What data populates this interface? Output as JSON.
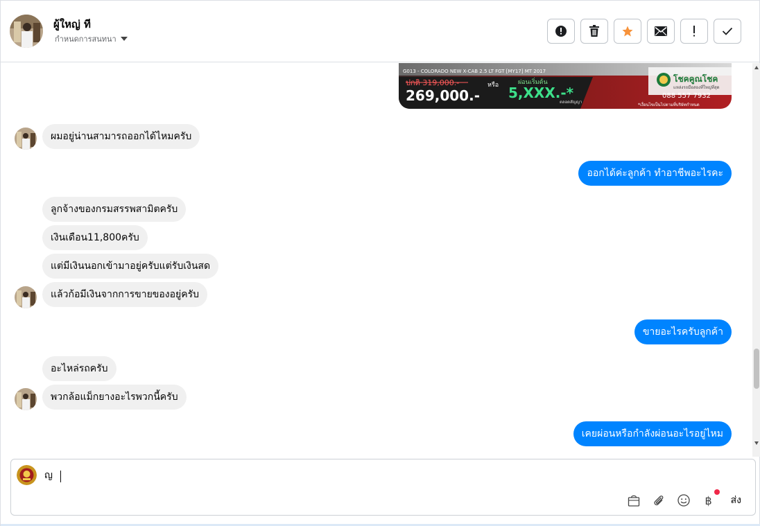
{
  "header": {
    "name": "ผู้ใหญ่ ที",
    "subtitle": "กำหนดการสนทนา",
    "actions": [
      {
        "name": "report-button",
        "icon": "alert-circle-icon"
      },
      {
        "name": "delete-button",
        "icon": "trash-icon"
      },
      {
        "name": "star-button",
        "icon": "star-icon"
      },
      {
        "name": "mark-unread-button",
        "icon": "envelope-icon"
      },
      {
        "name": "important-button",
        "icon": "exclamation-icon"
      },
      {
        "name": "done-button",
        "icon": "check-icon"
      }
    ]
  },
  "ad": {
    "model_line": "G013 - COLORADO NEW X-CAB 2.5 LT FGT [MY17] MT 2017",
    "old_price": "ปกติ 319,000.-",
    "price": "269,000.-",
    "or": "หรือ",
    "installment_label": "ผ่อนเริ่มต้น",
    "installment": "5,XXX.-*",
    "installment_note": "ตลอดสัญญา",
    "brand": "โชคคูณโชค",
    "brand_tagline": "แหล่งรถมือสองที่ใหญ่ที่สุด",
    "phone": "088 557 7932",
    "disclaimer": "*เงื่อนไขเป็นไปตามที่บริษัทกำหนด"
  },
  "messages": [
    {
      "dir": "in",
      "text": "ผมอยู่น่านสามารถออกได้ไหมครับ"
    },
    {
      "dir": "out",
      "text": "ออกได้ค่ะลูกค้า ทำอาชีพอะไรคะ"
    },
    {
      "dir": "in",
      "text": "ลูกจ้างของกรมสรรพสามิตครับ"
    },
    {
      "dir": "in",
      "text": "เงินเดือน11,800ครับ"
    },
    {
      "dir": "in",
      "text": "แต่มีเงินนอกเข้ามาอยู่ครับแต่รับเงินสด"
    },
    {
      "dir": "in",
      "text": "แล้วก้อมีเงินจากการขายของอยู่ครับ"
    },
    {
      "dir": "out",
      "text": "ขายอะไรครับลูกค้า"
    },
    {
      "dir": "in",
      "text": "อะไหล่รถครับ"
    },
    {
      "dir": "in",
      "text": "พวกล้อแม็กยางอะไรพวกนี้ครับ"
    },
    {
      "dir": "out",
      "text": "เคยผ่อนหรือกำลังผ่อนอะไรอยู่ไหม"
    }
  ],
  "composer": {
    "value": "ญ",
    "send_label": "ส่ง",
    "baht_symbol": "฿",
    "tools": [
      "shopping-bag-icon",
      "paperclip-icon",
      "emoji-icon",
      "baht-icon"
    ]
  },
  "colors": {
    "outgoing": "#0084ff",
    "incoming": "#f0f0f0",
    "star": "#f7923a",
    "notification": "#f02849"
  }
}
